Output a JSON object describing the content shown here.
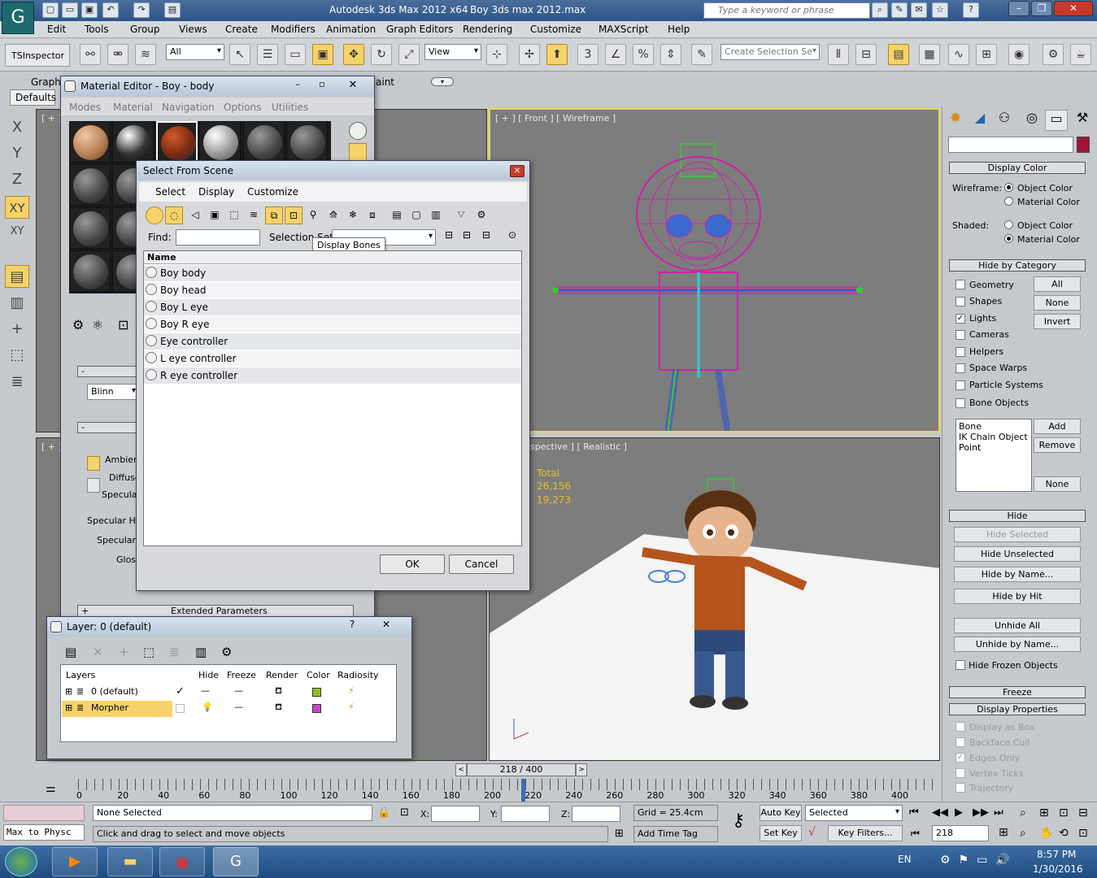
{
  "window": {
    "app_title": "Autodesk 3ds Max  2012 x64",
    "file_title": "Boy 3ds max 2012.max",
    "search_placeholder": "Type a keyword or phrase"
  },
  "menu": [
    "Edit",
    "Tools",
    "Group",
    "Views",
    "Create",
    "Modifiers",
    "Animation",
    "Graph Editors",
    "Rendering",
    "Customize",
    "MAXScript",
    "Help"
  ],
  "toolbar": {
    "inspector": "TSInspector",
    "filter": "All",
    "refcoord": "View",
    "selection_set_placeholder": "Create Selection Se",
    "snap_number": "3"
  },
  "ribbon": {
    "graph_tab": "Graph",
    "paint_tab": "aint",
    "defaults_tab": "Defaults"
  },
  "left_axes": [
    "X",
    "Y",
    "Z",
    "XY",
    "XY"
  ],
  "material_editor": {
    "title": "Material Editor - Boy - body",
    "menu": [
      "Modes",
      "Material",
      "Navigation",
      "Options",
      "Utilities"
    ],
    "shader": "Blinn",
    "ambient": "Ambien",
    "diffuse": "Diffuse",
    "specular": "Specular",
    "specular_group": "Specular Hi",
    "specular_level": "Specular L",
    "gloss": "Gloss",
    "extended": "Extended Parameters"
  },
  "select_from_scene": {
    "title": "Select From Scene",
    "menu": [
      "Select",
      "Display",
      "Customize"
    ],
    "find_label": "Find:",
    "selection_set_label": "Selection Set",
    "tooltip": "Display Bones",
    "column_name": "Name",
    "items": [
      "Boy body",
      "Boy head",
      "Boy L eye",
      "Boy R eye",
      "Eye controller",
      "L eye controller",
      "R eye controller"
    ],
    "ok": "OK",
    "cancel": "Cancel"
  },
  "layer_dialog": {
    "title": "Layer: 0 (default)",
    "columns": [
      "Layers",
      "Hide",
      "Freeze",
      "Render",
      "Color",
      "Radiosity"
    ],
    "rows": [
      {
        "name": "0 (default)",
        "color": "#8fbf1f"
      },
      {
        "name": "Morpher",
        "color": "#cc44cc"
      }
    ]
  },
  "viewports": {
    "top_left": "[ + ]",
    "front": "[ + ] [ Front ] [ Wireframe ]",
    "bottom_left": "[ + ]",
    "perspective": "spective ] [ Realistic ]",
    "stats_total": "Total",
    "stats_polys": "26,156",
    "stats_verts": "19,273"
  },
  "command_panel": {
    "display_color": "Display Color",
    "wireframe": "Wireframe:",
    "shaded": "Shaded:",
    "object_color": "Object Color",
    "material_color": "Material Color",
    "hide_by_category": "Hide by Category",
    "categories": [
      "Geometry",
      "Shapes",
      "Lights",
      "Cameras",
      "Helpers",
      "Space Warps",
      "Particle Systems",
      "Bone Objects"
    ],
    "lights_checked": true,
    "cat_buttons": [
      "All",
      "None",
      "Invert"
    ],
    "list_items": [
      "Bone",
      "IK Chain Object",
      "Point"
    ],
    "add": "Add",
    "remove": "Remove",
    "none": "None",
    "hide": "Hide",
    "hide_buttons": [
      "Hide Selected",
      "Hide Unselected",
      "Hide by Name...",
      "Hide by Hit",
      "Unhide All",
      "Unhide by Name..."
    ],
    "hide_frozen": "Hide Frozen Objects",
    "freeze": "Freeze",
    "display_properties": "Display Properties",
    "disp_props": [
      "Display as Box",
      "Backface Cull",
      "Edges Only",
      "Vertex Ticks",
      "Trajectory"
    ]
  },
  "timeline": {
    "frame": "218 / 400",
    "ticks": [
      "0",
      "20",
      "40",
      "60",
      "80",
      "100",
      "120",
      "140",
      "160",
      "180",
      "200",
      "220",
      "240",
      "260",
      "280",
      "300",
      "320",
      "340",
      "360",
      "380",
      "400"
    ]
  },
  "status": {
    "maxscript": "Max to Physc",
    "selection": "None Selected",
    "prompt": "Click and drag to select and move objects",
    "x_label": "X:",
    "y_label": "Y:",
    "z_label": "Z:",
    "grid": "Grid = 25.4cm",
    "add_time_tag": "Add Time Tag",
    "auto_key": "Auto Key",
    "set_key": "Set Key",
    "key_mode": "Selected",
    "key_filters": "Key Filters...",
    "current_frame": "218"
  },
  "taskbar": {
    "lang": "EN",
    "time": "8:57 PM",
    "date": "1/30/2016"
  },
  "colors": {
    "accent": "#f6d36a",
    "wireframe": "#cc22aa",
    "stats": "#e8c020"
  }
}
